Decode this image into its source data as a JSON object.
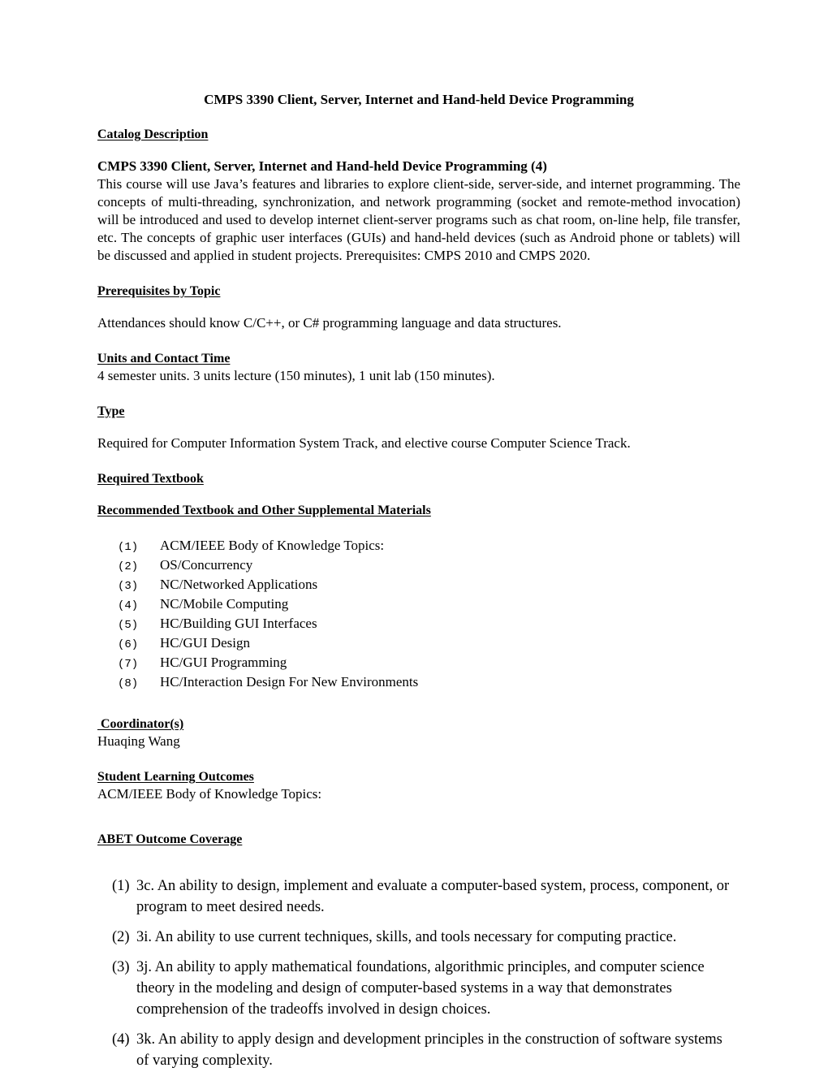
{
  "document": {
    "title": "CMPS 3390 Client, Server, Internet and Hand-held Device Programming"
  },
  "sections": {
    "catalog": {
      "heading": "Catalog Description",
      "course_line": "CMPS 3390 Client, Server, Internet and Hand-held Device Programming (4)",
      "body": "This course will use Java’s features and libraries to explore client-side, server-side, and internet programming. The concepts of multi-threading, synchronization, and network programming (socket and remote-method invocation) will be introduced and used to develop internet client-server programs such as chat room, on-line help, file transfer, etc. The concepts of graphic user interfaces (GUIs) and hand-held devices (such as Android phone or tablets) will be discussed and applied in student projects. Prerequisites: CMPS 2010 and CMPS 2020."
    },
    "prerequisites": {
      "heading": "Prerequisites by Topic",
      "body": "Attendances should know C/C++, or C# programming language and data structures."
    },
    "units": {
      "heading": "Units and Contact Time",
      "body": "4 semester units. 3 units lecture (150 minutes), 1 unit lab (150 minutes)."
    },
    "type": {
      "heading": "Type",
      "body": "Required for Computer Information System Track, and elective course Computer Science Track."
    },
    "required_textbook": {
      "heading": "Required Textbook"
    },
    "recommended_textbook": {
      "heading": "Recommended Textbook and Other Supplemental Materials",
      "items": [
        {
          "marker": "(1)",
          "text": "ACM/IEEE Body of Knowledge Topics:"
        },
        {
          "marker": "(2)",
          "text": "OS/Concurrency"
        },
        {
          "marker": "(3)",
          "text": "NC/Networked Applications"
        },
        {
          "marker": "(4)",
          "text": "NC/Mobile Computing"
        },
        {
          "marker": "(5)",
          "text": "HC/Building GUI Interfaces"
        },
        {
          "marker": "(6)",
          "text": "HC/GUI Design"
        },
        {
          "marker": "(7)",
          "text": "HC/GUI Programming"
        },
        {
          "marker": "(8)",
          "text": "HC/Interaction Design For New Environments"
        }
      ]
    },
    "coordinator": {
      "heading": " Coordinator(s)",
      "body": "Huaqing Wang"
    },
    "student_learning_outcomes": {
      "heading": "Student Learning Outcomes",
      "body": "ACM/IEEE Body of Knowledge Topics:"
    },
    "abet": {
      "heading": "ABET Outcome Coverage",
      "items": [
        {
          "marker": "(1)",
          "text": "3c.  An ability to design, implement and evaluate a computer-based system, process, component, or program to meet desired needs."
        },
        {
          "marker": "(2)",
          "text": "3i.  An ability to use current techniques, skills, and tools necessary for computing practice."
        },
        {
          "marker": "(3)",
          "text": "3j.  An ability to apply mathematical foundations, algorithmic principles, and computer science theory in the modeling and design of computer-based systems in a way that demonstrates comprehension of the tradeoffs involved in design choices."
        },
        {
          "marker": "(4)",
          "text": "3k.  An ability to apply design and development principles in the construction of software systems of varying complexity."
        }
      ]
    }
  }
}
